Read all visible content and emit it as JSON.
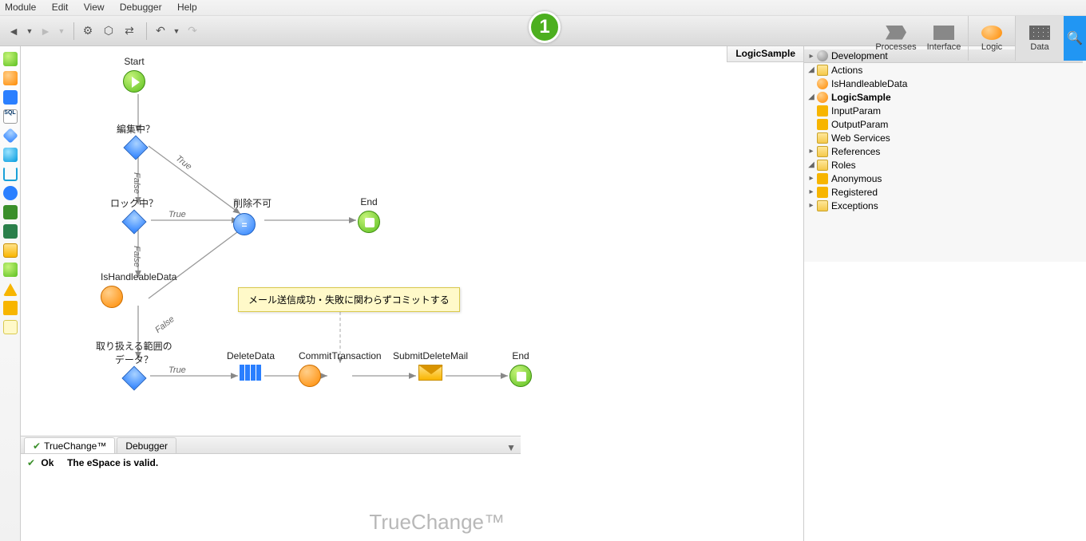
{
  "menu": {
    "module": "Module",
    "edit": "Edit",
    "view": "View",
    "debugger": "Debugger",
    "help": "Help"
  },
  "badge": "1",
  "navtabs": {
    "processes": "Processes",
    "interface": "Interface",
    "logic": "Logic",
    "data": "Data"
  },
  "canvas": {
    "tab": "LogicSample",
    "nodes": {
      "start": "Start",
      "editing": "編集中？",
      "locked": "ロック中？",
      "noDelete": "削除不可",
      "end1": "End",
      "isHandleable": "IsHandleableData",
      "rangeData1": "取り扱える範囲の",
      "rangeData2": "データ？",
      "deleteData": "DeleteData",
      "commit": "CommitTransaction",
      "submitMail": "SubmitDeleteMail",
      "end2": "End",
      "note": "メール送信成功・失敗に関わらずコミットする"
    },
    "edges": {
      "true": "True",
      "false": "False"
    }
  },
  "tree": {
    "root": "Development",
    "actions": "Actions",
    "isHandleable": "IsHandleableData",
    "logicSample": "LogicSample",
    "inputParam": "InputParam",
    "outputParam": "OutputParam",
    "webServices": "Web Services",
    "references": "References",
    "roles": "Roles",
    "anonymous": "Anonymous",
    "registered": "Registered",
    "exceptions": "Exceptions"
  },
  "bottom": {
    "tabTrueChange": "TrueChange™",
    "tabDebugger": "Debugger",
    "ok": "Ok",
    "msg": "The eSpace is valid.",
    "watermark": "TrueChange™"
  }
}
